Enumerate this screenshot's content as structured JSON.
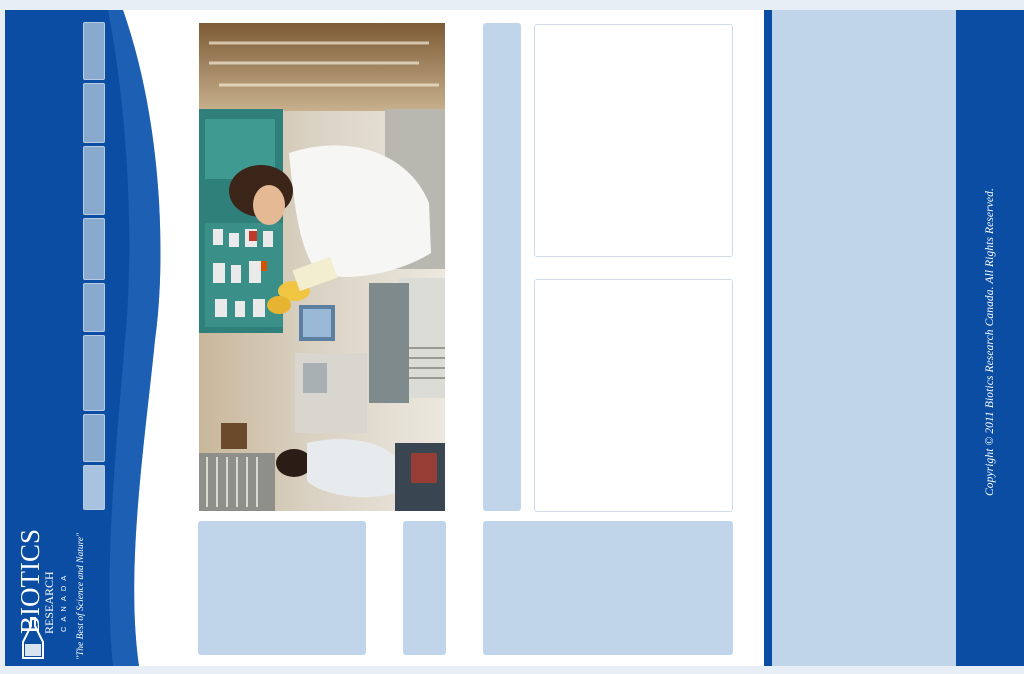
{
  "brand": {
    "name": "BIOTICS",
    "line2": "RESEARCH",
    "line3": "CANADA",
    "tagline": "\"The Best of Science and Nature\""
  },
  "nav": {
    "items": [
      {
        "id": "nav-1",
        "active": false
      },
      {
        "id": "nav-2",
        "active": false
      },
      {
        "id": "nav-3",
        "active": false
      },
      {
        "id": "nav-4",
        "active": false
      },
      {
        "id": "nav-5",
        "active": false
      },
      {
        "id": "nav-6",
        "active": false
      },
      {
        "id": "nav-7",
        "active": false
      },
      {
        "id": "nav-8",
        "active": true
      }
    ]
  },
  "hero": {
    "image": "laboratory-scientist-photo"
  },
  "footer": {
    "copyright": "Copyright © 2011 Biotics Research Canada. All Rights Reserved."
  },
  "colors": {
    "primary_blue": "#0a4da2",
    "light_blue": "#c1d5ea",
    "nav_blue": "#8aa9cf"
  }
}
